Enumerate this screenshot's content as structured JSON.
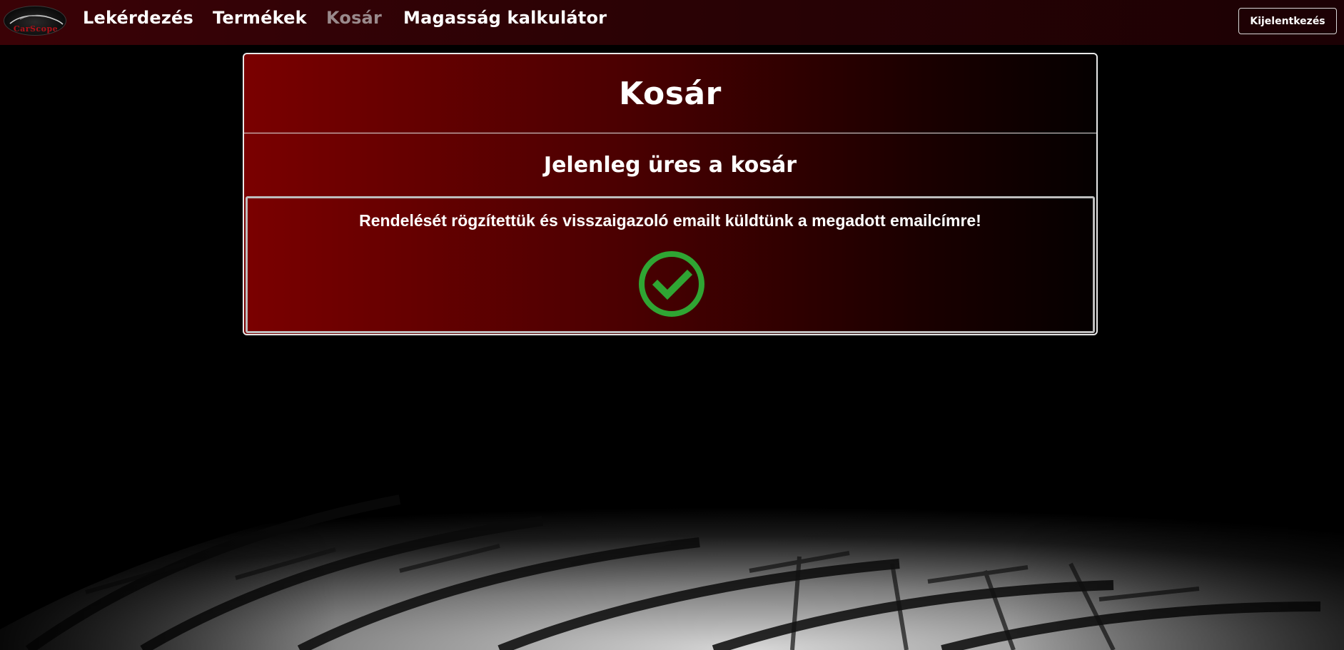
{
  "brand": {
    "logo_text": "CarScope"
  },
  "nav": {
    "items": [
      {
        "label": "Lekérdezés",
        "active": false
      },
      {
        "label": "Termékek",
        "active": false
      },
      {
        "label": "Kosár",
        "active": true
      },
      {
        "label": "Magasság kalkulátor",
        "active": false
      }
    ],
    "logout_label": "Kijelentkezés"
  },
  "cart": {
    "title": "Kosár",
    "empty_message": "Jelenleg üres a kosár",
    "confirmation_message": "Rendelését rögzítettük és visszaigazoló emailt küldtünk a megadott emailcímre!",
    "status_icon": "check-circle-icon"
  },
  "colors": {
    "accent_red": "#7a0000",
    "success_green": "#2fa533",
    "nav_active": "#9a8a8c"
  }
}
